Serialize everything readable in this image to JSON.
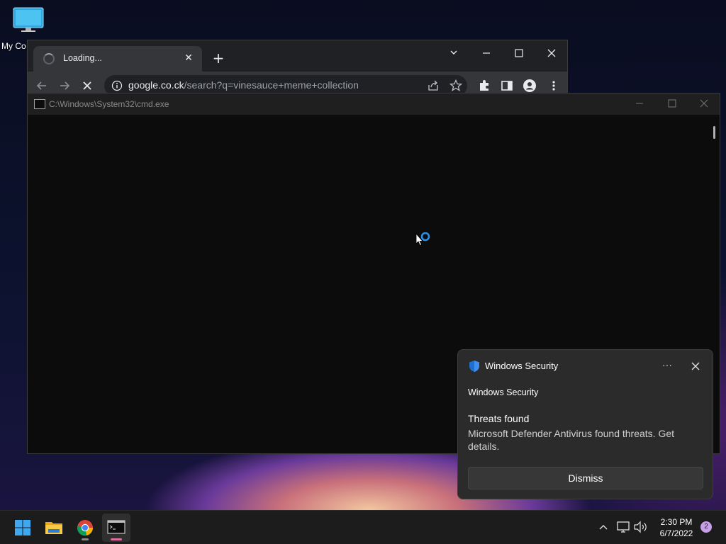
{
  "desktop": {
    "icons": [
      {
        "label": "My Co"
      }
    ]
  },
  "browser": {
    "tab": {
      "title": "Loading..."
    },
    "address": {
      "domain": "google.co.ck",
      "path": "/search?q=vinesauce+meme+collection"
    }
  },
  "cmd_window": {
    "title": "C:\\Windows\\System32\\cmd.exe"
  },
  "notification": {
    "app_name": "Windows Security",
    "attribution": "Windows Security",
    "heading": "Threats found",
    "body": "Microsoft Defender Antivirus found threats. Get details.",
    "dismiss_label": "Dismiss"
  },
  "taskbar": {
    "apps": [
      "start-icon",
      "file-explorer-icon",
      "chrome-icon",
      "cmd-icon"
    ],
    "time": "2:30 PM",
    "date": "6/7/2022",
    "notification_count": "2"
  },
  "colors": {
    "accent_blue": "#1a73e8",
    "shield_blue": "#1f6fd1",
    "badge_purple": "#c8a0e8",
    "active_indicator": "#e06ca0"
  }
}
